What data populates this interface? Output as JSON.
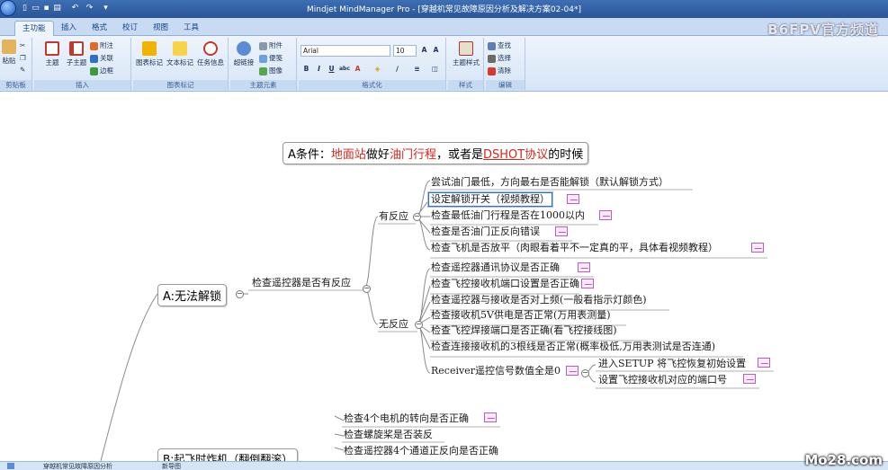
{
  "window": {
    "title": "Mindjet MindManager Pro - [穿越机常见故障原因分析及解决方案02-04*]",
    "watermark_top": "B6FPV官方频道",
    "watermark_bottom": "Mo28.com"
  },
  "tabs": [
    "主功能",
    "插入",
    "格式",
    "校订",
    "视图",
    "工具"
  ],
  "ribbon": {
    "clipboard": {
      "label": "剪贴板",
      "paste": "粘贴"
    },
    "insert": {
      "label": "插入",
      "topic": "主题",
      "subtopic": "子主题",
      "callout": "附注",
      "relationship": "关联",
      "boundary": "边框"
    },
    "markers": {
      "label": "图表标记",
      "icon_markers": "图表标记",
      "text_markers": "文本标记",
      "task_info": "任务信息"
    },
    "topic_elements": {
      "label": "主题元素",
      "hyperlink": "超链接",
      "attachment": "附件",
      "notes": "便笺",
      "image": "图像"
    },
    "format": {
      "label": "格式化",
      "font": "Arial",
      "size": "10"
    },
    "style": {
      "label": "样式",
      "topic_style": "主题样式"
    },
    "edit": {
      "label": "编辑",
      "find": "查找",
      "select": "选择",
      "clear": "清除"
    }
  },
  "map": {
    "central": {
      "prefix": "A条件：",
      "hl1": "地面站",
      "mid1": "做好",
      "hl2": "油门行程",
      "mid2": "，或者是",
      "hl3": "DSHOT",
      "hl4": "协议",
      "suffix": "的时候"
    },
    "main_topic_a": "A:无法解锁",
    "check_remote": "检查遥控器是否有反应",
    "has_response": "有反应",
    "no_response": "无反应",
    "has_items": [
      "尝试油门最低，方向最右是否能解锁（默认解锁方式）",
      "设定解锁开关（视频教程）",
      "检查最低油门行程是否在1000以内",
      "检查是否油门正反向错误",
      "检查飞机是否放平（肉眼看着平不一定真的平，具体看视频教程）"
    ],
    "no_items": [
      "检查遥控器通讯协议是否正确",
      "检查飞控接收机端口设置是否正确",
      "检查遥控器与接收是否对上频(一般看指示灯颜色)",
      "检查接收机5V供电是否正常(万用表测量)",
      "检查飞控焊接端口是否正确(看飞控接线图)",
      "检查连接接收机的3根线是否正常(概率极低,万用表测试是否连通)",
      "Receiver遥控信号数值全是0"
    ],
    "receiver_children": [
      "进入SETUP 将飞控恢复初始设置",
      "设置飞控接收机对应的端口号"
    ],
    "b_items": [
      "检查4个电机的转向是否正确",
      "检查螺旋桨是否装反",
      "检查遥控器4个通道正反向是否正确"
    ],
    "main_topic_b": "B:起飞时炸机（翻倒翻滚）"
  },
  "statusbar": {
    "doc1": "穿越机常见故障原因分析",
    "doc2": "新导图"
  }
}
